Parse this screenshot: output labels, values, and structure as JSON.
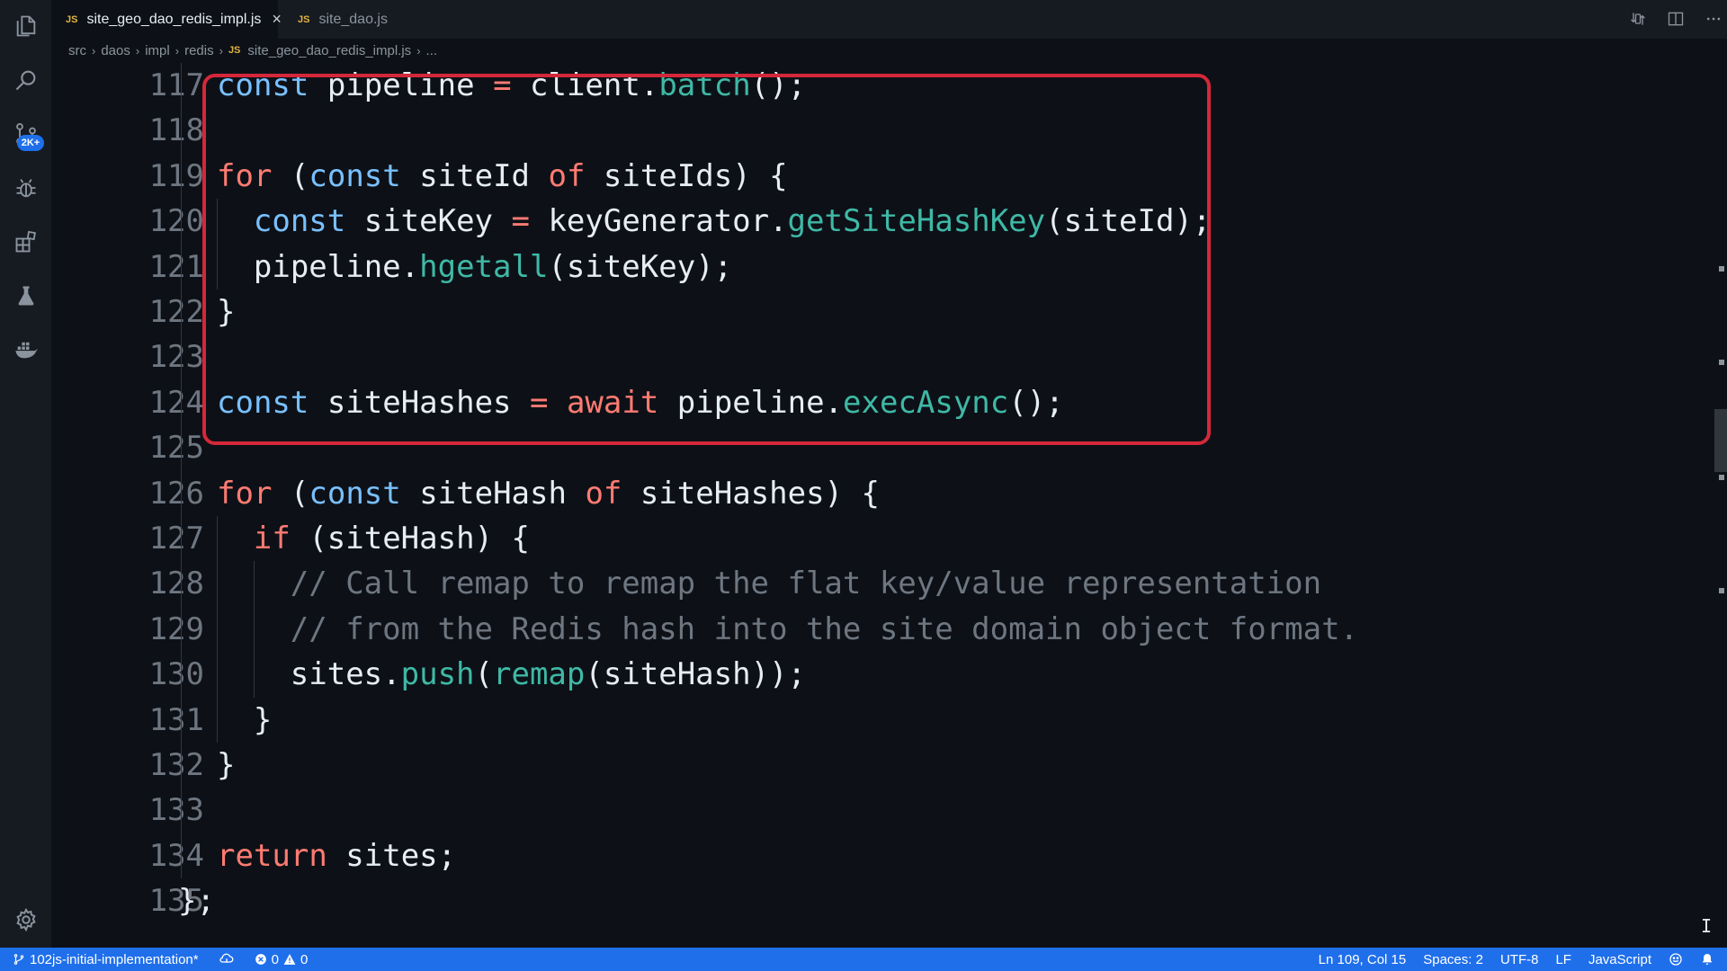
{
  "tabs": [
    {
      "icon": "JS",
      "label": "site_geo_dao_redis_impl.js",
      "active": true,
      "close": "×"
    },
    {
      "icon": "JS",
      "label": "site_dao.js",
      "active": false
    }
  ],
  "breadcrumb": {
    "items": [
      "src",
      "daos",
      "impl",
      "redis"
    ],
    "file_icon": "JS",
    "file": "site_geo_dao_redis_impl.js",
    "more": "..."
  },
  "activity_bar": {
    "badge": "2K+",
    "icons": [
      "explorer-icon",
      "search-icon",
      "source-control-icon",
      "debug-icon",
      "extensions-icon",
      "testing-flask-icon",
      "docker-icon",
      "settings-gear-icon"
    ]
  },
  "editor": {
    "lines": [
      {
        "n": "117",
        "indent": 1,
        "tokens": [
          [
            "kw2",
            "const"
          ],
          [
            "p",
            " pipeline "
          ],
          [
            "op",
            "="
          ],
          [
            "p",
            " client."
          ],
          [
            "fn",
            "batch"
          ],
          [
            "p",
            "();"
          ]
        ]
      },
      {
        "n": "118",
        "indent": 0,
        "tokens": []
      },
      {
        "n": "119",
        "indent": 1,
        "tokens": [
          [
            "kw",
            "for"
          ],
          [
            "p",
            " ("
          ],
          [
            "kw2",
            "const"
          ],
          [
            "p",
            " siteId "
          ],
          [
            "kw",
            "of"
          ],
          [
            "p",
            " siteIds) {"
          ]
        ]
      },
      {
        "n": "120",
        "indent": 2,
        "tokens": [
          [
            "kw2",
            "const"
          ],
          [
            "p",
            " siteKey "
          ],
          [
            "op",
            "="
          ],
          [
            "p",
            " keyGenerator."
          ],
          [
            "fn",
            "getSiteHashKey"
          ],
          [
            "p",
            "(siteId);"
          ]
        ]
      },
      {
        "n": "121",
        "indent": 2,
        "tokens": [
          [
            "p",
            "pipeline."
          ],
          [
            "fn",
            "hgetall"
          ],
          [
            "p",
            "(siteKey);"
          ]
        ]
      },
      {
        "n": "122",
        "indent": 1,
        "tokens": [
          [
            "p",
            "}"
          ]
        ]
      },
      {
        "n": "123",
        "indent": 0,
        "tokens": []
      },
      {
        "n": "124",
        "indent": 1,
        "tokens": [
          [
            "kw2",
            "const"
          ],
          [
            "p",
            " siteHashes "
          ],
          [
            "op",
            "="
          ],
          [
            "kw",
            " await"
          ],
          [
            "p",
            " pipeline."
          ],
          [
            "fn",
            "execAsync"
          ],
          [
            "p",
            "();"
          ]
        ]
      },
      {
        "n": "125",
        "indent": 0,
        "tokens": []
      },
      {
        "n": "126",
        "indent": 1,
        "tokens": [
          [
            "kw",
            "for"
          ],
          [
            "p",
            " ("
          ],
          [
            "kw2",
            "const"
          ],
          [
            "p",
            " siteHash "
          ],
          [
            "kw",
            "of"
          ],
          [
            "p",
            " siteHashes) {"
          ]
        ]
      },
      {
        "n": "127",
        "indent": 2,
        "tokens": [
          [
            "kw",
            "if"
          ],
          [
            "p",
            " (siteHash) {"
          ]
        ]
      },
      {
        "n": "128",
        "indent": 3,
        "tokens": [
          [
            "cm",
            "// Call remap to remap the flat key/value representation"
          ]
        ]
      },
      {
        "n": "129",
        "indent": 3,
        "tokens": [
          [
            "cm",
            "// from the Redis hash into the site domain object format."
          ]
        ]
      },
      {
        "n": "130",
        "indent": 3,
        "tokens": [
          [
            "p",
            "sites."
          ],
          [
            "fn",
            "push"
          ],
          [
            "p",
            "("
          ],
          [
            "fn",
            "remap"
          ],
          [
            "p",
            "(siteHash));"
          ]
        ]
      },
      {
        "n": "131",
        "indent": 2,
        "tokens": [
          [
            "p",
            "}"
          ]
        ]
      },
      {
        "n": "132",
        "indent": 1,
        "tokens": [
          [
            "p",
            "}"
          ]
        ]
      },
      {
        "n": "133",
        "indent": 0,
        "tokens": []
      },
      {
        "n": "134",
        "indent": 1,
        "tokens": [
          [
            "kw",
            "return"
          ],
          [
            "p",
            " sites;"
          ]
        ]
      },
      {
        "n": "135",
        "indent": 0,
        "tokens": [
          [
            "p",
            "};"
          ]
        ]
      }
    ]
  },
  "statusbar": {
    "branch": "102js-initial-implementation*",
    "errors": "0",
    "warnings": "0",
    "position": "Ln 109, Col 15",
    "spaces": "Spaces: 2",
    "encoding": "UTF-8",
    "eol": "LF",
    "language": "JavaScript"
  },
  "colors": {
    "accent": "#1f6feb",
    "highlight_border": "#d4283a",
    "keyword": "#ff7b72",
    "storage": "#79c0ff",
    "function": "#3fb9a6",
    "comment": "#6e7681"
  }
}
